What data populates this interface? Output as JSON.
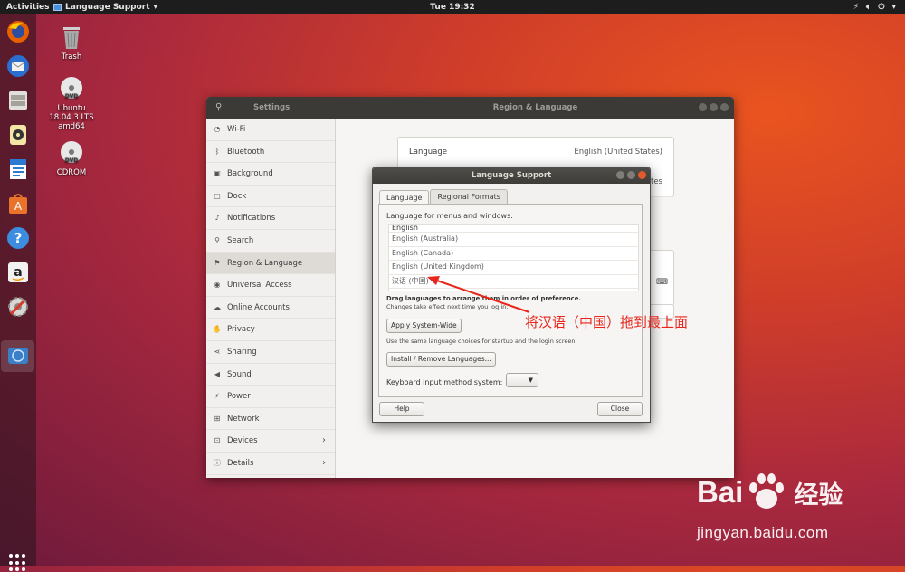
{
  "topbar": {
    "activities": "Activities",
    "app_menu": "Language Support",
    "clock": "Tue 19:32"
  },
  "desktop_icons": [
    {
      "label": "Trash",
      "icon": "trash-icon"
    },
    {
      "label": "Ubuntu\n18.04.3 LTS\namd64",
      "line1": "Ubuntu",
      "line2": "18.04.3 LTS",
      "line3": "amd64",
      "icon": "dvd-icon"
    },
    {
      "label": "CDROM",
      "icon": "dvd-icon"
    }
  ],
  "dock": [
    "firefox-icon",
    "thunderbird-icon",
    "files-icon",
    "rhythmbox-icon",
    "writer-icon",
    "software-center-icon",
    "help-icon",
    "amazon-icon",
    "settings-icon",
    "language-support-icon"
  ],
  "settings": {
    "search_glyph": "⚲",
    "title_left": "Settings",
    "title_right": "Region & Language",
    "sidebar": [
      {
        "label": "Wi-Fi",
        "icon": "wifi-icon"
      },
      {
        "label": "Bluetooth",
        "icon": "bluetooth-icon"
      },
      {
        "label": "Background",
        "icon": "background-icon"
      },
      {
        "label": "Dock",
        "icon": "dock-icon"
      },
      {
        "label": "Notifications",
        "icon": "bell-icon"
      },
      {
        "label": "Search",
        "icon": "search-icon"
      },
      {
        "label": "Region & Language",
        "icon": "flag-icon",
        "selected": true
      },
      {
        "label": "Universal Access",
        "icon": "accessibility-icon"
      },
      {
        "label": "Online Accounts",
        "icon": "cloud-icon"
      },
      {
        "label": "Privacy",
        "icon": "hand-icon"
      },
      {
        "label": "Sharing",
        "icon": "share-icon"
      },
      {
        "label": "Sound",
        "icon": "speaker-icon"
      },
      {
        "label": "Power",
        "icon": "power-icon"
      },
      {
        "label": "Network",
        "icon": "network-icon"
      },
      {
        "label": "Devices",
        "icon": "devices-icon",
        "chevron": true
      },
      {
        "label": "Details",
        "icon": "info-icon",
        "chevron": true
      }
    ],
    "language_row": {
      "key": "Language",
      "value": "English (United States)"
    },
    "formats_row_value_fragment": "tes"
  },
  "dialog": {
    "title": "Language Support",
    "tabs": [
      "Language",
      "Regional Formats"
    ],
    "menus_label": "Language for menus and windows:",
    "languages": [
      "English",
      "English (Australia)",
      "English (Canada)",
      "English (United Kingdom)",
      "汉语 (中国)"
    ],
    "drag_note": "Drag languages to arrange them in order of preference.",
    "change_note": "Changes take effect next time you log in.",
    "apply_button": "Apply System-Wide",
    "same_note": "Use the same language choices for startup and the login screen.",
    "install_button": "Install / Remove Languages...",
    "keyboard_label": "Keyboard input method system:",
    "help_button": "Help",
    "close_button": "Close"
  },
  "annotation": {
    "text": "将汉语（中国）拖到最上面",
    "color": "#e8251a"
  },
  "watermark": {
    "logo_left": "Bai",
    "logo_right": "经验",
    "url": "jingyan.baidu.com"
  }
}
